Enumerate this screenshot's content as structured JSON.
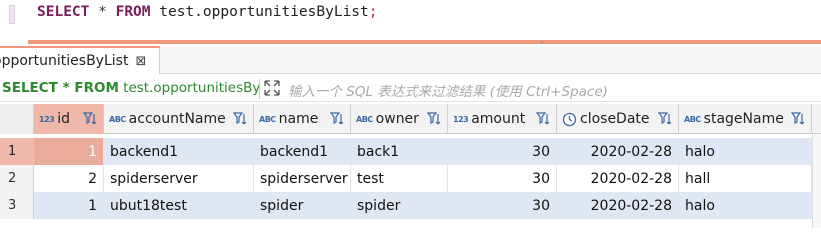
{
  "editor": {
    "sql": {
      "kw_select": "SELECT",
      "star": "*",
      "kw_from": "FROM",
      "table": "test.opportunitiesByList",
      "semicolon": ";"
    }
  },
  "results_tab": {
    "label": "opportunitiesByList",
    "close": "⊠"
  },
  "filter": {
    "query_prefix": "SELECT * FROM",
    "query_rest": " test.opportunitiesByLi",
    "placeholder": "输入一个 SQL 表达式来过滤结果 (使用 Ctrl+Space)"
  },
  "grid": {
    "columns": [
      {
        "type_badge": "123",
        "name": "id"
      },
      {
        "type_badge": "ABC",
        "name": "accountName"
      },
      {
        "type_badge": "ABC",
        "name": "name"
      },
      {
        "type_badge": "ABC",
        "name": "owner"
      },
      {
        "type_badge": "123",
        "name": "amount"
      },
      {
        "type_badge": "clock",
        "name": "closeDate"
      },
      {
        "type_badge": "ABC",
        "name": "stageName"
      }
    ],
    "rows": [
      {
        "num": "1",
        "id": "1",
        "accountName": "backend1",
        "name": "backend1",
        "owner": "back1",
        "amount": "30",
        "closeDate": "2020-02-28",
        "stageName": "halo"
      },
      {
        "num": "2",
        "id": "2",
        "accountName": "spiderserver",
        "name": "spiderserver",
        "owner": "test",
        "amount": "30",
        "closeDate": "2020-02-28",
        "stageName": "hall"
      },
      {
        "num": "3",
        "id": "1",
        "accountName": "ubut18test",
        "name": "spider",
        "owner": "spider",
        "amount": "30",
        "closeDate": "2020-02-28",
        "stageName": "halo"
      }
    ]
  },
  "colors": {
    "accent": "#f0997a",
    "selection": "#efb8aa",
    "row_alt": "#dfe7f4",
    "keyword": "#7a1f5c",
    "filter_query": "#2b8a2b"
  }
}
